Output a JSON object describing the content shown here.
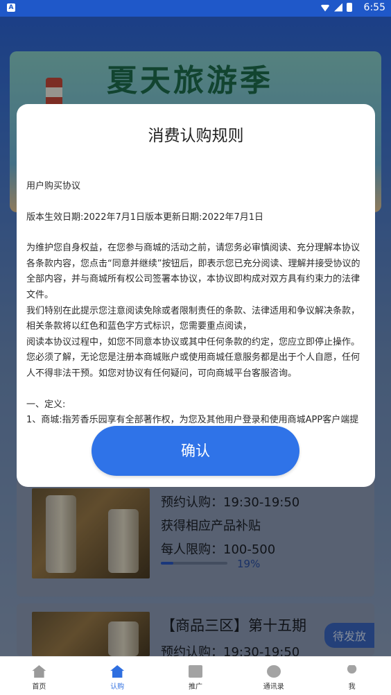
{
  "status": {
    "app_icon": "A",
    "time": "6:55"
  },
  "banner": {
    "title": "夏天旅游季"
  },
  "products": [
    {
      "reserve": "预约认购：19:30-19:50",
      "subsidy": "获得相应产品补贴",
      "limit": "每人限购：100-500",
      "progress": 0.19,
      "progress_label": "19%"
    },
    {
      "title": "【商品三区】第十五期",
      "badge": "待发放",
      "reserve": "预约认购：19:30-19:50"
    }
  ],
  "modal": {
    "title": "消费认购规则",
    "agreement_title": "用户购买协议",
    "dates": "版本生效日期:2022年7月1日版本更新日期:2022年7月1日",
    "para1": "为维护您自身权益，在您参与商城的活动之前，请您务必审慎阅读、充分理解本协议各条款内容，您点击“同意并继续”按钮后，即表示您已充分阅读、理解并接受协议的全部内容，并与商城所有权公司签署本协议，本协议即构成对双方具有约束力的法律文件。",
    "para2": "我们特别在此提示您注意阅读免除或者限制责任的条款、法律适用和争议解决条款，相关条款将以红色和蓝色字方式标识，您需要重点阅读，",
    "para3": "阅读本协议过程中，如您不同意本协议或其中任何条款的约定，您应立即停止操作。",
    "para4": "您必须了解，无论您是注册本商城账户或使用商城任意服务都是出于个人自愿，任何人不得非法干预。如您对协议有任何疑问，可向商城平台客服咨询。",
    "section1": "一、定义:",
    "item1": "1、商城:指芳香乐园享有全部著作权，为您及其他用户登录和使用商城APP客户端提",
    "confirm_label": "确认"
  },
  "tabbar": {
    "items": [
      {
        "label": "首页",
        "icon": "home-icon"
      },
      {
        "label": "认购",
        "icon": "home-icon",
        "active": true
      },
      {
        "label": "推广",
        "icon": "promo-icon"
      },
      {
        "label": "通讯录",
        "icon": "chat-icon"
      },
      {
        "label": "我",
        "icon": "user-icon"
      }
    ]
  },
  "colors": {
    "accent": "#2f73e8",
    "status_bar": "#1f58c9"
  }
}
